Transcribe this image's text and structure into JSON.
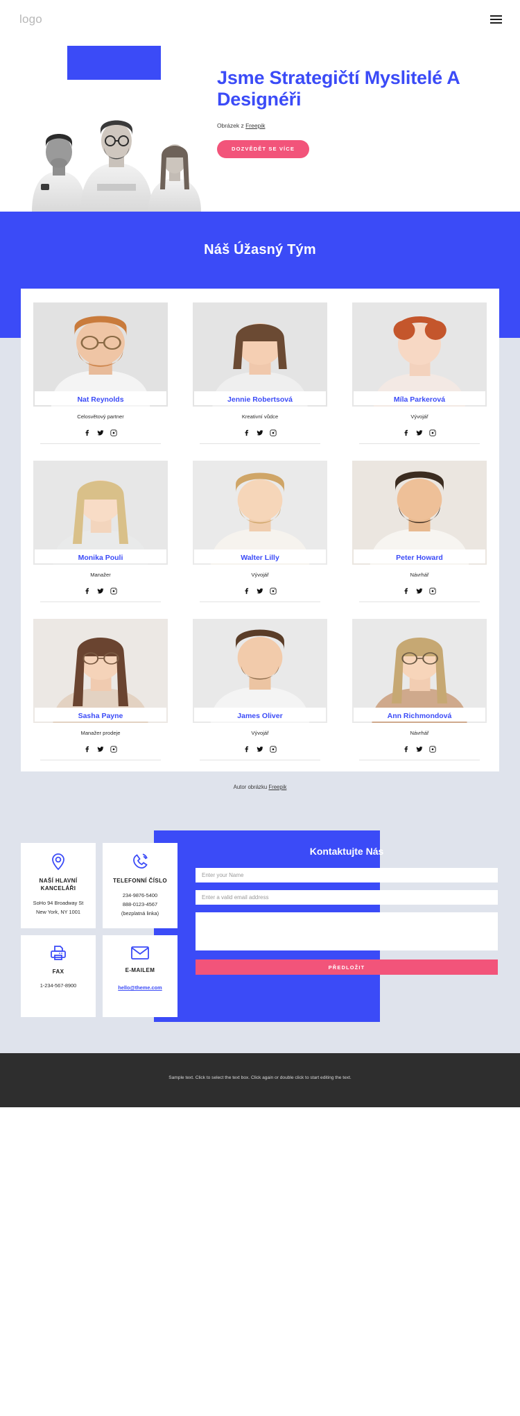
{
  "header": {
    "logo": "logo",
    "menu_icon": "hamburger-menu-icon"
  },
  "hero": {
    "title": "Jsme Strategičtí Myslitelé A Designéři",
    "credit_prefix": "Obrázek z ",
    "credit_link": "Freepik",
    "cta_label": "DOZVĚDĚT SE VÍCE",
    "accent_blue": "#3b4bf7",
    "accent_pink": "#f2547a"
  },
  "team": {
    "heading": "Náš Úžasný Tým",
    "credit_prefix": "Autor obrázku ",
    "credit_link": "Freepik",
    "members": [
      {
        "name": "Nat Reynolds",
        "role": "Celosvětový partner"
      },
      {
        "name": "Jennie Robertsová",
        "role": "Kreativní vůdce"
      },
      {
        "name": "Míla Parkerová",
        "role": "Vývojář"
      },
      {
        "name": "Monika Pouli",
        "role": "Manažer"
      },
      {
        "name": "Walter Lilly",
        "role": "Vývojář"
      },
      {
        "name": "Peter Howard",
        "role": "Návrhář"
      },
      {
        "name": "Sasha Payne",
        "role": "Manažer prodeje"
      },
      {
        "name": "James Oliver",
        "role": "Vývojář"
      },
      {
        "name": "Ann Richmondová",
        "role": "Návrhář"
      }
    ],
    "social_icons": [
      "facebook-icon",
      "twitter-icon",
      "instagram-icon"
    ]
  },
  "contact": {
    "cards": [
      {
        "icon": "location-pin-icon",
        "title": "NAŠÍ HLAVNÍ KANCELÁŘI",
        "lines": [
          "SoHo 94 Broadway St",
          "New York, NY 1001"
        ]
      },
      {
        "icon": "phone-icon",
        "title": "TELEFONNÍ ČÍSLO",
        "lines": [
          "234-9876-5400",
          "888-0123-4567",
          "(bezplatná linka)"
        ]
      },
      {
        "icon": "fax-printer-icon",
        "title": "FAX",
        "lines": [
          "1-234-567-8900"
        ]
      },
      {
        "icon": "envelope-icon",
        "title": "E-MAILEM",
        "link": "hello@theme.com"
      }
    ],
    "form": {
      "title": "Kontaktujte Nás",
      "name_placeholder": "Enter your Name",
      "name_value": "",
      "email_placeholder": "Enter a valid email address",
      "email_value": "",
      "message_placeholder": "",
      "message_value": "",
      "submit_label": "PŘEDLOŽIT"
    }
  },
  "footer": {
    "text": "Sample text. Click to select the text box. Click again or double click to start editing the text."
  }
}
